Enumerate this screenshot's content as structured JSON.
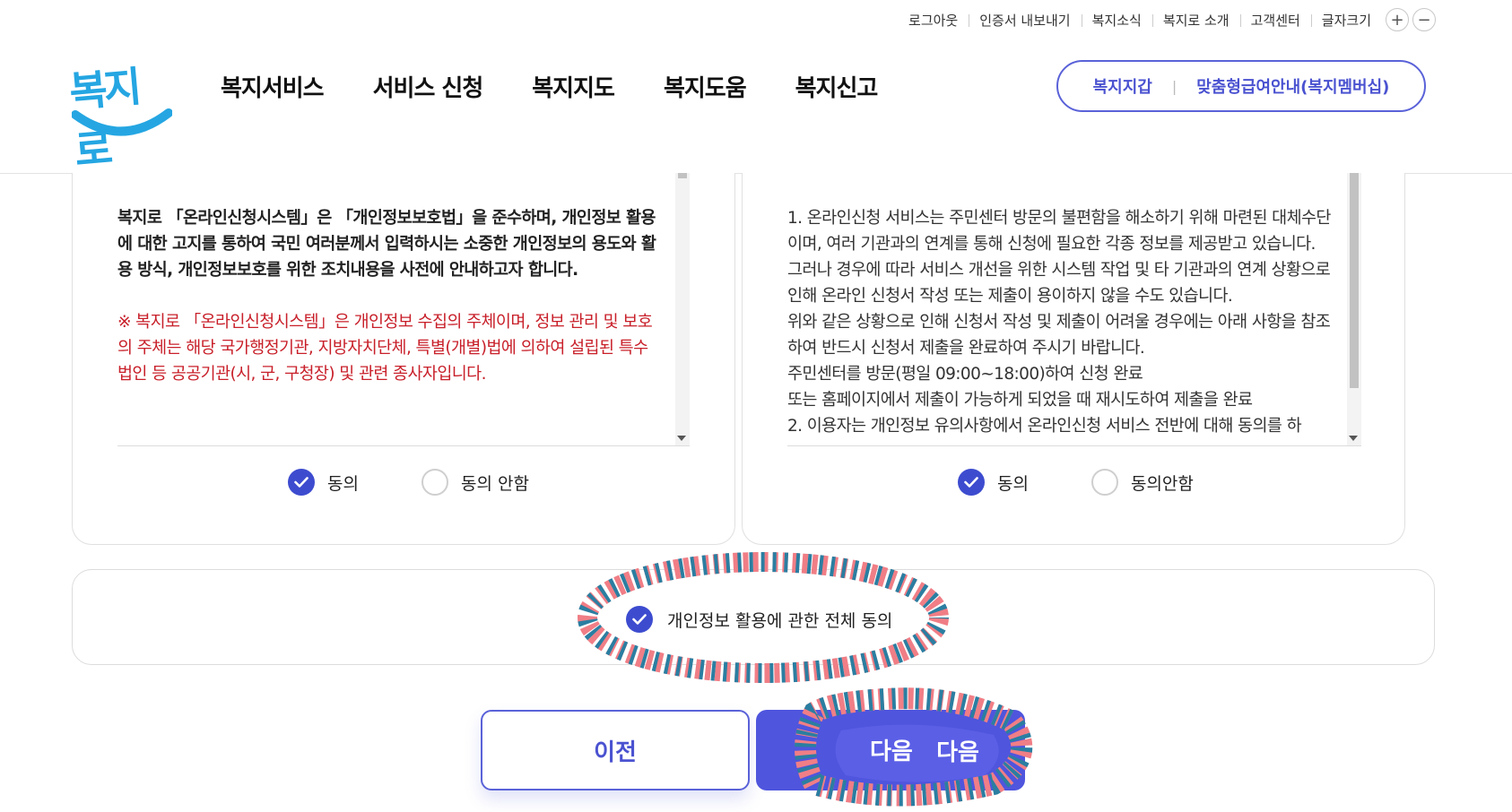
{
  "utility": {
    "items": [
      "로그아웃",
      "인증서 내보내기",
      "복지소식",
      "복지로 소개",
      "고객센터",
      "글자크기"
    ],
    "plus": "+",
    "minus": "−"
  },
  "logo": {
    "text": "복지로"
  },
  "gnb": {
    "items": [
      "복지서비스",
      "서비스 신청",
      "복지지도",
      "복지도움",
      "복지신고"
    ]
  },
  "pill": {
    "left": "복지지갑",
    "sep": "|",
    "right": "맞춤형급여안내(복지멤버십)"
  },
  "left_panel": {
    "intro": "복지로 「온라인신청시스템」은 「개인정보보호법」을 준수하며, 개인정보 활용에 대한 고지를 통하여 국민 여러분께서 입력하시는 소중한 개인정보의 용도와 활용 방식, 개인정보보호를 위한 조치내용을 사전에 안내하고자 합니다.",
    "notice": "※ 복지로 「온라인신청시스템」은 개인정보 수집의 주체이며, 정보 관리 및 보호의 주체는 해당 국가행정기관, 지방자치단체, 특별(개별)법에 의하여 설립된 특수법인 등 공공기관(시, 군, 구청장) 및 관련 종사자입니다.",
    "agree": "동의",
    "disagree": "동의 안함"
  },
  "right_panel": {
    "lines": [
      "1. 온라인신청 서비스는 주민센터 방문의 불편함을 해소하기 위해 마련된 대체수단이며, 여러 기관과의 연계를 통해 신청에 필요한 각종 정보를 제공받고 있습니다.",
      "그러나 경우에 따라 서비스 개선을 위한 시스템 작업 및 타 기관과의 연계 상황으로 인해 온라인 신청서 작성 또는 제출이 용이하지 않을 수도 있습니다.",
      "위와 같은 상황으로 인해 신청서 작성 및 제출이 어려울 경우에는 아래 사항을 참조하여 반드시 신청서 제출을 완료하여 주시기 바랍니다.",
      "주민센터를 방문(평일 09:00~18:00)하여 신청 완료",
      "또는 홈페이지에서 제출이 가능하게 되었을 때 재시도하여 제출을 완료",
      "2. 이용자는 개인정보 유의사항에서 온라인신청 서비스 전반에 대해 동의를 하"
    ],
    "agree": "동의",
    "disagree": "동의안함"
  },
  "all_agree": {
    "label": "개인정보 활용에 관한 전체 동의"
  },
  "buttons": {
    "prev": "이전",
    "next": "다음"
  },
  "colors": {
    "accent": "#4f55dd",
    "notice_red": "#c8202a",
    "logo_blue": "#25a6e2"
  }
}
